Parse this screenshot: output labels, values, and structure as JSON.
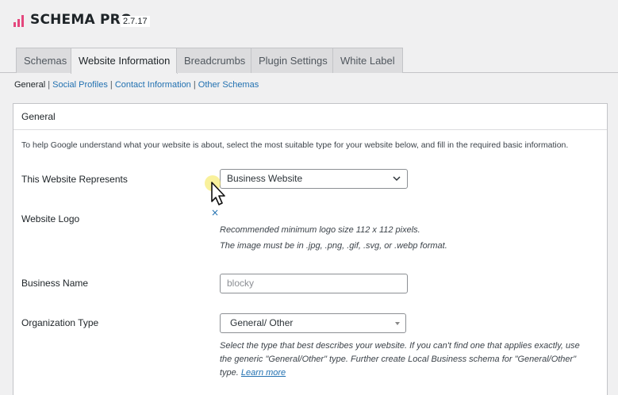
{
  "header": {
    "title": "SCHEMA PRO",
    "version": "2.7.17",
    "brand_color": "#e4477d"
  },
  "tabs": [
    {
      "label": "Schemas",
      "active": false
    },
    {
      "label": "Website Information",
      "active": true
    },
    {
      "label": "Breadcrumbs",
      "active": false
    },
    {
      "label": "Plugin Settings",
      "active": false
    },
    {
      "label": "White Label",
      "active": false
    }
  ],
  "subnav": [
    {
      "label": "General",
      "current": true
    },
    {
      "label": "Social Profiles",
      "current": false
    },
    {
      "label": "Contact Information",
      "current": false
    },
    {
      "label": "Other Schemas",
      "current": false
    }
  ],
  "panel": {
    "title": "General",
    "intro": "To help Google understand what your website is about, select the most suitable type for your website below, and fill in the required basic information.",
    "represents": {
      "label": "This Website Represents",
      "value": "Business Website"
    },
    "logo": {
      "label": "Website Logo",
      "remove_icon": "×",
      "hint1": "Recommended minimum logo size 112 x 112 pixels.",
      "hint2": "The image must be in .jpg, .png, .gif, .svg, or .webp format."
    },
    "business_name": {
      "label": "Business Name",
      "value": "blocky"
    },
    "organization_type": {
      "label": "Organization Type",
      "value": "General/ Other",
      "description": "Select the type that best describes your website. If you can't find one that applies exactly, use the generic \"General/Other\" type. Further create Local Business schema for \"General/Other\" type.",
      "learn_more": "Learn more"
    }
  },
  "icons": {
    "logo": "schema-pro-logo-icon",
    "dropdown": "chevron-down-icon",
    "cursor": "mouse-pointer-icon"
  }
}
